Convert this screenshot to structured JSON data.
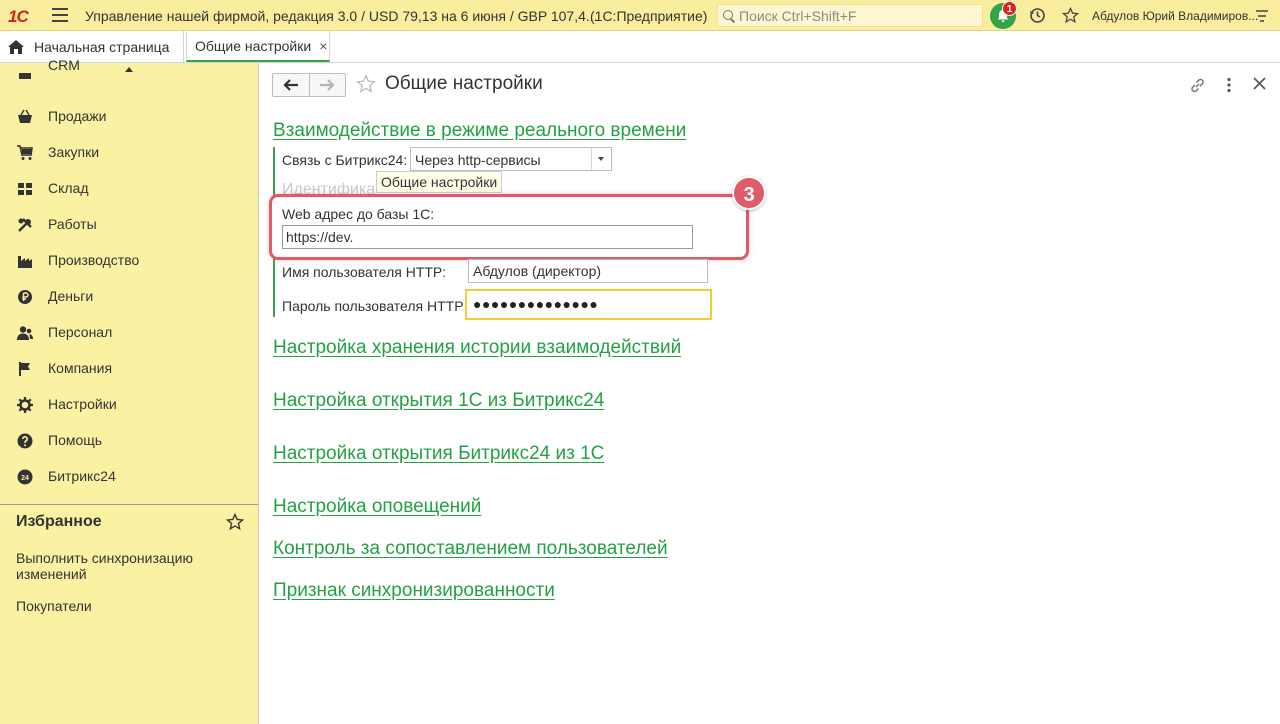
{
  "topbar": {
    "logo": "1С",
    "title": "Управление нашей фирмой, редакция 3.0 / USD 79,13 на 6 июня / GBP 107,4...",
    "mode": "(1С:Предприятие)",
    "search_placeholder": "Поиск Ctrl+Shift+F",
    "notification_count": "1",
    "user": "Абдулов Юрий Владимиров..."
  },
  "tabs": {
    "home": "Начальная страница",
    "active": "Общие настройки",
    "close_symbol": "×"
  },
  "sidebar": {
    "items": [
      {
        "label": "CRM",
        "icon": "crm-icon"
      },
      {
        "label": "Продажи",
        "icon": "basket-icon"
      },
      {
        "label": "Закупки",
        "icon": "cart-icon"
      },
      {
        "label": "Склад",
        "icon": "warehouse-icon"
      },
      {
        "label": "Работы",
        "icon": "tools-icon"
      },
      {
        "label": "Производство",
        "icon": "factory-icon"
      },
      {
        "label": "Деньги",
        "icon": "ruble-icon"
      },
      {
        "label": "Персонал",
        "icon": "people-icon"
      },
      {
        "label": "Компания",
        "icon": "flag-icon"
      },
      {
        "label": "Настройки",
        "icon": "gear-icon"
      },
      {
        "label": "Помощь",
        "icon": "help-icon"
      },
      {
        "label": "Битрикс24",
        "icon": "bitrix24-icon"
      }
    ],
    "favorites_title": "Избранное",
    "favorites": [
      "Выполнить синхронизацию изменений",
      "Покупатели"
    ]
  },
  "page": {
    "title": "Общие настройки",
    "sections": {
      "realtime": "Взаимодействие в режиме реального времени",
      "history": "Настройка хранения истории взаимодействий",
      "open_1c": "Настройка открытия 1С из Битрикс24",
      "open_b24": "Настройка открытия Битрикс24 из 1С",
      "notifications": "Настройка оповещений",
      "users_match": "Контроль за сопоставлением пользователей",
      "sync_flag": "Признак синхронизированности"
    },
    "form": {
      "connection_label": "Связь с Битрикс24:",
      "connection_value": "Через http-сервисы",
      "ident_label": "Идентифика",
      "tooltip": "Общие настройки",
      "web_label": "Web адрес до базы 1С:",
      "web_value": "https://dev.",
      "http_user_label": "Имя пользователя HTTP:",
      "http_user_value": "Абдулов (директор)",
      "http_password_label": "Пароль пользователя HTTP:",
      "http_password_value": "●●●●●●●●●●●●●●"
    },
    "step_badge": "3"
  },
  "colors": {
    "topbar_bg": "#fbed9e",
    "sidebar_bg": "#fbf1a3",
    "link_green": "#24a145",
    "highlight_red": "#e05a67",
    "focus_yellow": "#f2cc33"
  }
}
